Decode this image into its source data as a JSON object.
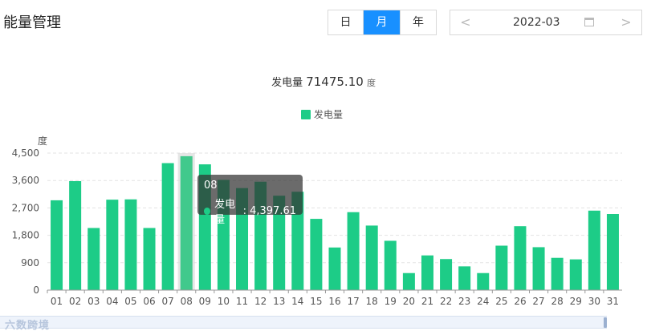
{
  "page": {
    "title": "能量管理"
  },
  "period_tabs": [
    {
      "label": "日",
      "active": false
    },
    {
      "label": "月",
      "active": true
    },
    {
      "label": "年",
      "active": false
    }
  ],
  "date_picker": {
    "value": "2022-03",
    "prev": "<",
    "next": ">"
  },
  "summary": {
    "label": "发电量",
    "value": "71475.10",
    "unit": "度"
  },
  "legend": {
    "label": "发电量"
  },
  "watermark": "六数跨境",
  "tooltip": {
    "category": "08",
    "series": "发电量",
    "value": "4,397.61"
  },
  "colors": {
    "bar": "#1dcc87",
    "highlight_bar": "#41c98c",
    "accent": "#1890ff"
  },
  "chart_data": {
    "type": "bar",
    "ylabel": "度",
    "ylim": [
      0,
      4500
    ],
    "yticks": [
      0,
      900,
      1800,
      2700,
      3600,
      4500
    ],
    "ytick_labels": [
      "0",
      "900",
      "1,800",
      "2,700",
      "3,600",
      "4,500"
    ],
    "categories": [
      "01",
      "02",
      "03",
      "04",
      "05",
      "06",
      "07",
      "08",
      "09",
      "10",
      "11",
      "12",
      "13",
      "14",
      "15",
      "16",
      "17",
      "18",
      "19",
      "20",
      "21",
      "22",
      "23",
      "24",
      "25",
      "26",
      "27",
      "28",
      "29",
      "30",
      "31"
    ],
    "series": [
      {
        "name": "发电量",
        "values": [
          2950,
          3580,
          2040,
          2970,
          2980,
          2040,
          4170,
          4397.61,
          4130,
          3620,
          3350,
          3560,
          3100,
          3230,
          2340,
          1400,
          2560,
          2120,
          1620,
          560,
          1140,
          1020,
          780,
          560,
          1460,
          2100,
          1410,
          1060,
          1010,
          2610,
          2500
        ]
      }
    ],
    "highlight_index": 7,
    "grid": true,
    "legend_position": "top-center"
  }
}
